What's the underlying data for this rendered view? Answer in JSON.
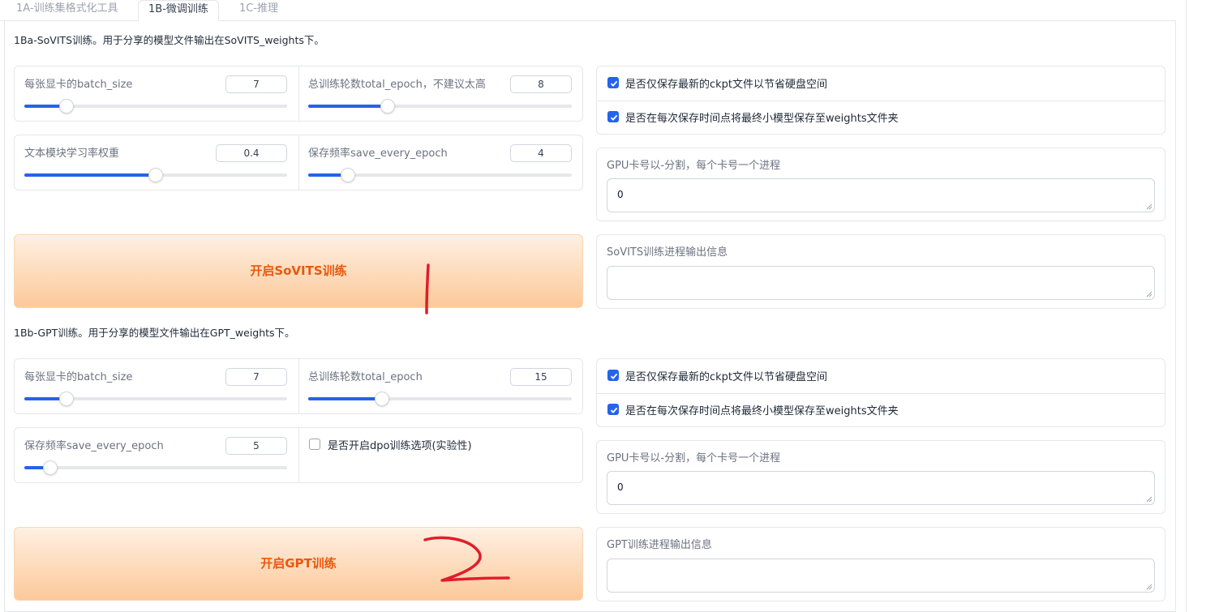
{
  "tabs": [
    {
      "label": "1A-训练集格式化工具"
    },
    {
      "label": "1B-微调训练"
    },
    {
      "label": "1C-推理"
    }
  ],
  "sovits": {
    "title": "1Ba-SoVITS训练。用于分享的模型文件输出在SoVITS_weights下。",
    "batch_size": {
      "label": "每张显卡的batch_size",
      "value": "7",
      "fraction": 0.16
    },
    "total_epoch": {
      "label": "总训练轮数total_epoch，不建议太高",
      "value": "8",
      "fraction": 0.3
    },
    "text_lr_weight": {
      "label": "文本模块学习率权重",
      "value": "0.4",
      "fraction": 0.5
    },
    "save_every_epoch": {
      "label": "保存频率save_every_epoch",
      "value": "4",
      "fraction": 0.15
    },
    "save_latest_only": {
      "label": "是否仅保存最新的ckpt文件以节省硬盘空间",
      "checked": true
    },
    "save_to_weights": {
      "label": "是否在每次保存时间点将最终小模型保存至weights文件夹",
      "checked": true
    },
    "gpu_field": {
      "label": "GPU卡号以-分割，每个卡号一个进程",
      "value": "0"
    },
    "start_button": "开启SoVITS训练",
    "output_label": "SoVITS训练进程输出信息",
    "output_value": ""
  },
  "gpt": {
    "title": "1Bb-GPT训练。用于分享的模型文件输出在GPT_weights下。",
    "batch_size": {
      "label": "每张显卡的batch_size",
      "value": "7",
      "fraction": 0.16
    },
    "total_epoch": {
      "label": "总训练轮数total_epoch",
      "value": "15",
      "fraction": 0.28
    },
    "save_every_epoch": {
      "label": "保存频率save_every_epoch",
      "value": "5",
      "fraction": 0.1
    },
    "dpo": {
      "label": "是否开启dpo训练选项(实验性)",
      "checked": false
    },
    "save_latest_only": {
      "label": "是否仅保存最新的ckpt文件以节省硬盘空间",
      "checked": true
    },
    "save_to_weights": {
      "label": "是否在每次保存时间点将最终小模型保存至weights文件夹",
      "checked": true
    },
    "gpu_field": {
      "label": "GPU卡号以-分割，每个卡号一个进程",
      "value": "0"
    },
    "start_button": "开启GPT训练",
    "output_label": "GPT训练进程输出信息",
    "output_value": ""
  },
  "annotations": {
    "mark_1": "1",
    "mark_2": "2",
    "color": "#e11d2a"
  },
  "colors": {
    "accent": "#2563eb",
    "button_text": "#ea580c",
    "button_bg_top": "#fef0e3",
    "button_bg_bottom": "#fcc999"
  }
}
